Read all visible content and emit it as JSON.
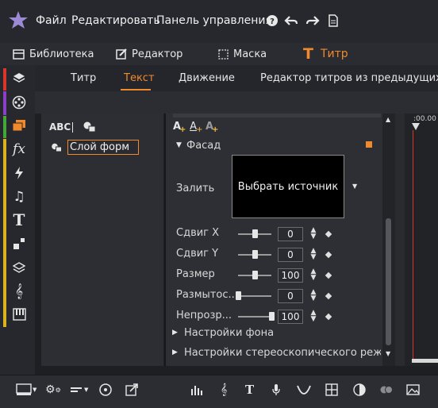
{
  "menu": {
    "file": "Файл",
    "edit": "Редактировать",
    "control_panel": "Панель управления"
  },
  "modes": [
    {
      "label": "Библиотека",
      "icon": "library-icon"
    },
    {
      "label": "Редактор",
      "icon": "editor-icon"
    },
    {
      "label": "Маска",
      "icon": "mask-icon"
    },
    {
      "label": "Титр",
      "icon": "title-icon",
      "active": true
    }
  ],
  "subtabs": [
    {
      "label": "Титр"
    },
    {
      "label": "Текст",
      "active": true
    },
    {
      "label": "Движение"
    },
    {
      "label": "Редактор титров из предыдущих ве"
    }
  ],
  "left_panel": {
    "abc_label": "ABC",
    "layer_name": "Слой форм"
  },
  "facade": {
    "section_title": "Фасад",
    "fill_label": "Залить",
    "source_button": "Выбрать источник"
  },
  "properties": [
    {
      "label": "Сдвиг X",
      "value": "0",
      "level": 0.5
    },
    {
      "label": "Сдвиг Y",
      "value": "0",
      "level": 0.5
    },
    {
      "label": "Размер",
      "value": "100",
      "level": 0.5
    },
    {
      "label": "Размытос...",
      "value": "0",
      "level": 0.0
    },
    {
      "label": "Непрозр...",
      "value": "100",
      "level": 1.0
    }
  ],
  "collapsed_sections": [
    {
      "label": "Настройки фона"
    },
    {
      "label": "Настройки стереоскопического режи"
    }
  ],
  "timeline": {
    "timecode": ":00.00"
  },
  "colors": {
    "accent": "#f08a2c",
    "background": "#1e1f23",
    "panel": "#2e2f34",
    "sidebar_strips": [
      "#d8352b",
      "#8b3fc7",
      "#42a83a",
      "#d9b21e"
    ]
  }
}
